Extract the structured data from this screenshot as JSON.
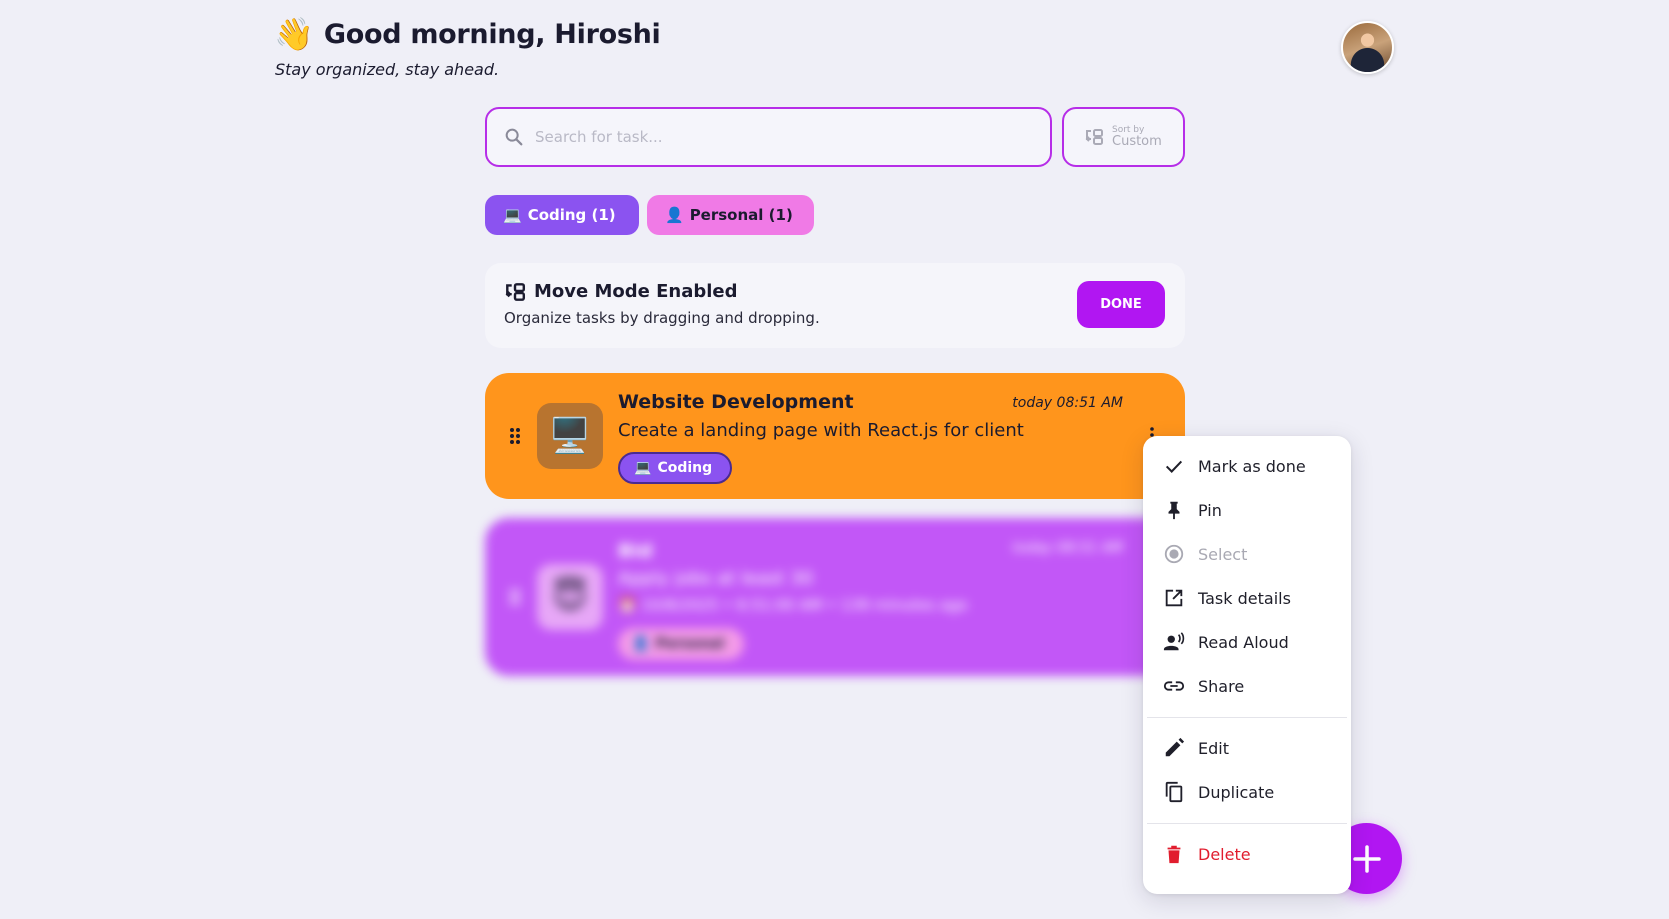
{
  "header": {
    "wave_emoji": "👋",
    "greeting": "Good morning, Hiroshi",
    "subtitle": "Stay organized, stay ahead."
  },
  "search": {
    "placeholder": "Search for task..."
  },
  "sort": {
    "label": "Sort by",
    "value": "Custom"
  },
  "categories": [
    {
      "emoji": "💻",
      "label": "Coding (1)",
      "color": "#8b53f0"
    },
    {
      "emoji": "👤",
      "label": "Personal (1)",
      "color": "#f07ae6"
    }
  ],
  "move_mode": {
    "title": "Move Mode Enabled",
    "description": "Organize tasks by dragging and dropping.",
    "done_label": "DONE"
  },
  "tasks": [
    {
      "emoji": "🖥️",
      "name": "Website Development",
      "description": "Create a landing page with React.js for client",
      "date": "today 08:51 AM",
      "tag_emoji": "💻",
      "tag": "Coding",
      "color": "#ff951c"
    },
    {
      "emoji": "😇",
      "name": "Bid",
      "description": "Apply jobs at least 30",
      "time": "⏰ 10/8/2025 • 6:51:00 AM • 139 minutes ago",
      "date": "today 08:51 AM",
      "tag_emoji": "👤",
      "tag": "Personal",
      "color": "#c257f7"
    }
  ],
  "menu": {
    "mark_done": "Mark as done",
    "pin": "Pin",
    "select": "Select",
    "task_details": "Task details",
    "read_aloud": "Read Aloud",
    "share": "Share",
    "edit": "Edit",
    "duplicate": "Duplicate",
    "delete": "Delete"
  },
  "colors": {
    "accent": "#b116f2",
    "background": "#efeff7",
    "danger": "#e11d2e"
  }
}
